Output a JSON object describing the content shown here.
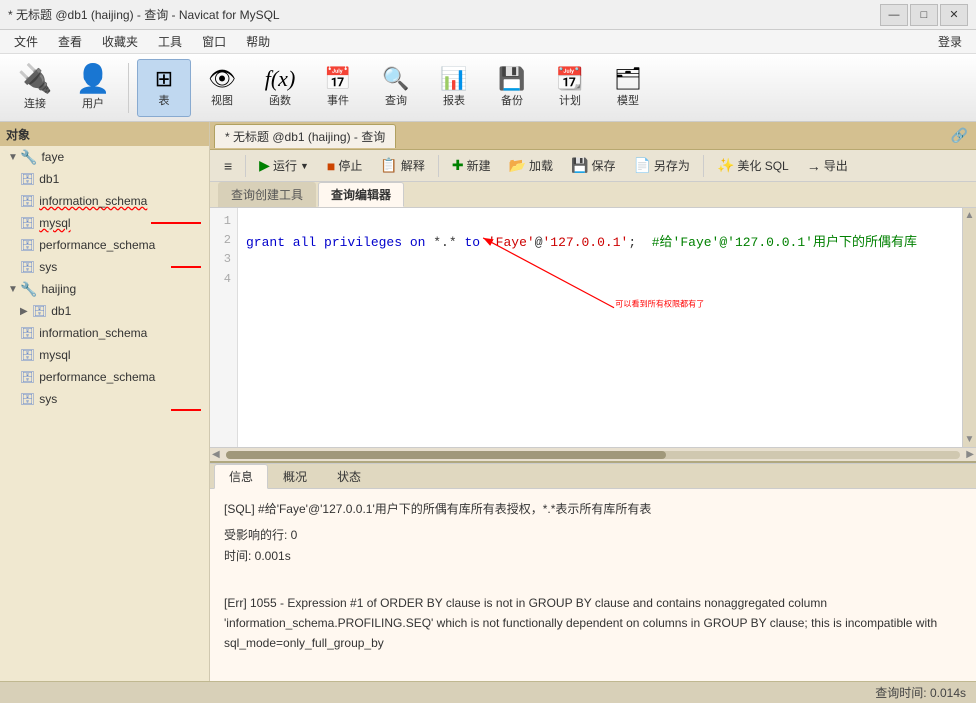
{
  "titleBar": {
    "title": "* 无标题 @db1 (haijing) - 查询 - Navicat for MySQL",
    "controls": [
      "—",
      "□",
      "✕"
    ]
  },
  "menuBar": {
    "items": [
      "文件",
      "查看",
      "收藏夹",
      "工具",
      "窗口",
      "帮助"
    ],
    "right": "登录"
  },
  "toolbar": {
    "items": [
      {
        "id": "connect",
        "icon": "🔌",
        "label": "连接"
      },
      {
        "id": "user",
        "icon": "👤",
        "label": "用户"
      },
      {
        "id": "table",
        "icon": "⊞",
        "label": "表",
        "active": true
      },
      {
        "id": "view",
        "icon": "👁",
        "label": "视图"
      },
      {
        "id": "func",
        "icon": "∫",
        "label": "函数"
      },
      {
        "id": "event",
        "icon": "📅",
        "label": "事件"
      },
      {
        "id": "query",
        "icon": "🔍",
        "label": "查询"
      },
      {
        "id": "report",
        "icon": "📊",
        "label": "报表"
      },
      {
        "id": "backup",
        "icon": "💾",
        "label": "备份"
      },
      {
        "id": "schedule",
        "icon": "📆",
        "label": "计划"
      },
      {
        "id": "model",
        "icon": "🗂",
        "label": "模型"
      }
    ]
  },
  "sidebar": {
    "header": "对象",
    "faye": {
      "label": "faye",
      "children": [
        "db1",
        "information_schema",
        "mysql",
        "performance_schema",
        "sys"
      ]
    },
    "haijing": {
      "label": "haijing",
      "children": [
        {
          "label": "db1",
          "expanded": true,
          "children": []
        },
        "information_schema",
        "mysql",
        "performance_schema",
        "sys"
      ]
    }
  },
  "queryTab": {
    "label": "* 无标题 @db1 (haijing) - 查询"
  },
  "queryToolbar": {
    "buttons": [
      {
        "id": "menu",
        "icon": "≡",
        "label": ""
      },
      {
        "id": "run",
        "icon": "▶",
        "label": "运行"
      },
      {
        "id": "stop",
        "icon": "■",
        "label": "停止"
      },
      {
        "id": "explain",
        "icon": "📋",
        "label": "解释"
      },
      {
        "id": "new",
        "icon": "✚",
        "label": "新建"
      },
      {
        "id": "load",
        "icon": "📂",
        "label": "加载"
      },
      {
        "id": "save",
        "icon": "💾",
        "label": "保存"
      },
      {
        "id": "saveas",
        "icon": "📄",
        "label": "另存为"
      },
      {
        "id": "beautify",
        "icon": "✨",
        "label": "美化 SQL"
      },
      {
        "id": "export",
        "icon": "→",
        "label": "导出"
      }
    ]
  },
  "subTabs": [
    "查询创建工具",
    "查询编辑器"
  ],
  "activeSubTab": "查询编辑器",
  "codeLines": [
    {
      "num": "1",
      "content": ""
    },
    {
      "num": "2",
      "content": "grant all privileges on *.* to 'Faye'@'127.0.0.1';  #给'Faye'@'127.0.0.1'用户下的所偶有库"
    },
    {
      "num": "3",
      "content": ""
    },
    {
      "num": "4",
      "content": ""
    }
  ],
  "annotation": "可以看到所有权限都有了",
  "infoTabs": [
    "信息",
    "概况",
    "状态"
  ],
  "activeInfoTab": "信息",
  "infoContent": {
    "sql": "[SQL]  #给'Faye'@'127.0.0.1'用户下的所偶有库所有表授权，*.*表示所有库所有表",
    "affected": "受影响的行: 0",
    "time": "时间: 0.001s",
    "error": "[Err] 1055 - Expression #1 of ORDER BY clause is not in GROUP BY clause and contains nonaggregated column 'information_schema.PROFILING.SEQ' which is not functionally dependent on columns in GROUP BY clause; this is incompatible with sql_mode=only_full_group_by"
  },
  "statusBar": {
    "queryTime": "查询时间: 0.014s"
  }
}
